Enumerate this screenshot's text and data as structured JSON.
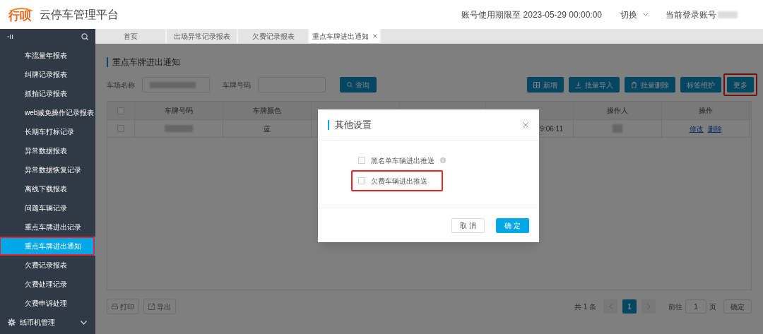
{
  "header": {
    "logo": "行呗",
    "title": "云停车管理平台",
    "expiry": "账号使用期限至 2023-05-29 00:00:00",
    "switch": "切换",
    "account_label": "当前登录账号"
  },
  "sidebar": {
    "items": [
      {
        "label": "车流量年报表",
        "selected": false
      },
      {
        "label": "纠牌记录报表",
        "selected": false
      },
      {
        "label": "抓拍记录报表",
        "selected": false
      },
      {
        "label": "web减免操作记录报表",
        "selected": false
      },
      {
        "label": "长期车打标记录",
        "selected": false
      },
      {
        "label": "异常数据报表",
        "selected": false
      },
      {
        "label": "异常数据恢复记录",
        "selected": false
      },
      {
        "label": "离线下载报表",
        "selected": false
      },
      {
        "label": "问题车辆记录",
        "selected": false
      },
      {
        "label": "重点车牌进出记录",
        "selected": false
      },
      {
        "label": "重点车牌进出通知",
        "selected": true,
        "highlighted": true
      },
      {
        "label": "欠费记录报表",
        "selected": false
      },
      {
        "label": "欠费处理记录",
        "selected": false
      },
      {
        "label": "欠费申诉处理",
        "selected": false
      }
    ],
    "group": {
      "label": "纸币机管理",
      "expanded": false
    }
  },
  "tabs": [
    {
      "label": "首页",
      "selected": false
    },
    {
      "label": "出场异常记录报表",
      "selected": false
    },
    {
      "label": "欠费记录报表",
      "selected": false
    },
    {
      "label": "重点车牌进出通知",
      "selected": true,
      "closable": true
    }
  ],
  "page": {
    "title": "重点车牌进出通知",
    "filters": [
      {
        "label": "车场名称",
        "redacted": true
      },
      {
        "label": "车牌号码",
        "redacted": false
      }
    ],
    "search_button": "查询",
    "toolbar": [
      {
        "label": "新增",
        "highlighted": false
      },
      {
        "label": "批量导入",
        "highlighted": false
      },
      {
        "label": "批量删除",
        "highlighted": false
      },
      {
        "label": "标签维护",
        "highlighted": false
      },
      {
        "label": "更多",
        "highlighted": true
      }
    ],
    "table": {
      "select_all_checked": false,
      "columns": [
        "车牌号码",
        "车牌颜色",
        "",
        "",
        "",
        "操作人",
        "操作"
      ],
      "rows": [
        {
          "checked": false,
          "plate_redacted": true,
          "plate_color": "蓝",
          "time": "9:06:11",
          "operator_redacted": true,
          "actions": [
            "修改",
            "删除"
          ]
        }
      ]
    },
    "footer_buttons": [
      "打印",
      "导出"
    ],
    "pagination": {
      "total": "共 1 条",
      "pages": [
        {
          "label": "1",
          "selected": true
        }
      ],
      "goto": "前往",
      "goto_value": "1",
      "page_unit": "页",
      "confirm": "确定"
    }
  },
  "dialog": {
    "title": "其他设置",
    "options": [
      {
        "label": "黑名单车辆进出推送",
        "checked": false,
        "info": true,
        "highlighted": false
      },
      {
        "label": "欠费车辆进出推送",
        "checked": false,
        "info": false,
        "highlighted": true
      }
    ],
    "buttons": [
      {
        "label": "取 消",
        "kind": "secondary"
      },
      {
        "label": "确 定",
        "kind": "primary"
      }
    ]
  }
}
